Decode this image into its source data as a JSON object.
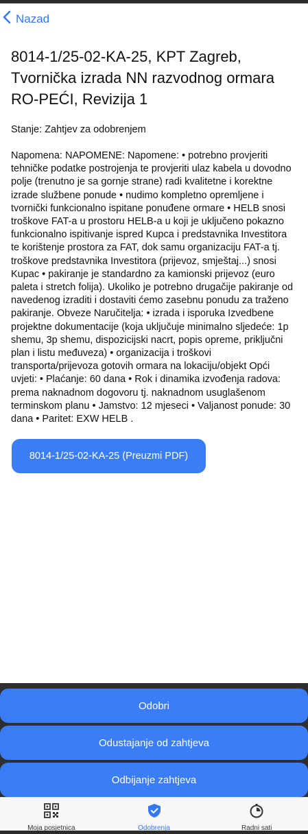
{
  "nav": {
    "back_label": "Nazad"
  },
  "request": {
    "title": "8014-1/25-02-KA-25, KPT Zagreb, Tvornička izrada NN razvodnog ormara RO-PEĆI, Revizija 1",
    "status": "Stanje: Zahtjev za odobrenjem",
    "note": "Napomena: NAPOMENE: Napomene: • potrebno provjeriti tehničke podatke postrojenja te provjeriti ulaz kabela u dovodno polje (trenutno je sa gornje strane) radi kvalitetne i korektne izrade službene ponude • nudimo kompletno opremljene i tvornički funkcionalno ispitane ponuđene ormare • HELB snosi troškove FAT-a u prostoru HELB-a u koji je uključeno pokazno funkcionalno ispitivanje ispred Kupca i predstavnika Investitora te korištenje prostora za FAT, dok samu organizaciju FAT-a tj. troškove predstavnika Investitora (prijevoz, smještaj...) snosi Kupac • pakiranje je standardno za kamionski prijevoz (euro paleta i stretch folija). Ukoliko je potrebno drugačije pakiranje od navedenog izraditi i dostaviti ćemo zasebnu ponudu za traženo pakiranje. Obveze Naručitelja: • izrada i isporuka Izvedbene projektne dokumentacije (koja uključuje minimalno sljedeće: 1p shemu, 3p shemu, dispozicijski nacrt, popis opreme, priključni plan i listu međuveza) • organizacija i troškovi transporta/prijevoza gotovih ormara na lokaciju/objekt Opći uvjeti: • Plaćanje: 60 dana • Rok i dinamika izvođenja radova: prema naknadnom dogovoru tj. naknadnom usuglašenom terminskom planu • Jamstvo: 12 mjeseci • Valjanost ponude: 30 dana • Paritet: EXW HELB .",
    "pdf_button": "8014-1/25-02-KA-25 (Preuzmi PDF)"
  },
  "actions": {
    "approve": "Odobri",
    "withdraw": "Odustajanje od zahtjeva",
    "reject": "Odbijanje zahtjeva"
  },
  "tabbar": {
    "tabs": [
      {
        "label": "Moja posjetnica",
        "icon": "qr-code-icon"
      },
      {
        "label": "Odobrenja",
        "icon": "shield-check-icon"
      },
      {
        "label": "Radni sati",
        "icon": "stopwatch-icon"
      }
    ],
    "active_index": 1
  },
  "colors": {
    "accent": "#3478f6",
    "button": "#3b7df7",
    "text": "#111111"
  }
}
